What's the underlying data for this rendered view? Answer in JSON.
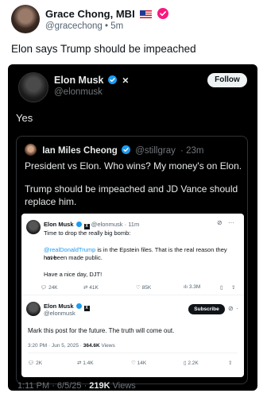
{
  "post": {
    "author_name": "Grace Chong, MBI",
    "author_handle": "@gracechong",
    "dot": "•",
    "age": "5m",
    "text": "Elon says Trump should be impeached"
  },
  "embed": {
    "author_name": "Elon Musk",
    "author_handle": "@elonmusk",
    "follow_label": "Follow",
    "text": "Yes",
    "meta_time": "1:11 PM · 6/5/25 · ",
    "meta_views": "219K",
    "meta_views_label": " Views",
    "quote": {
      "author_name": "Ian Miles Cheong",
      "author_handle": "@stillgray",
      "age": "· 23m",
      "text1": "President vs Elon. Who wins? My money's on Elon.",
      "text2": "Trump should be impeached and JD Vance should replace him."
    }
  },
  "screenshot": {
    "tweet1": {
      "author_name": "Elon Musk",
      "author_handle": "@elonmusk",
      "age": "· 11m",
      "line1": "Time to drop the really big bomb:",
      "mention": "@realDonaldTrump",
      "line2_rest": " is in the Epstein files. That is the real reason they have",
      "line3": "not been made public.",
      "line4": "Have a nice day, DJT!",
      "replies": "24K",
      "reposts": "41K",
      "likes": "85K",
      "views": "3.3M"
    },
    "tweet2": {
      "author_name": "Elon Musk",
      "author_handle": "@elonmusk",
      "subscribe_label": "Subscribe",
      "text": "Mark this post for the future. The truth will come out.",
      "meta_time": "3:20 PM · Jun 5, 2025 · ",
      "meta_views": "364.6K",
      "meta_views_label": " Views",
      "replies": "2K",
      "reposts": "1.4K",
      "likes": "14K",
      "bookmarks": "2.2K"
    }
  },
  "colors": {
    "brand_blue": "#1d9bf0",
    "badge_pink": "#f91880",
    "card_bg": "#000000"
  },
  "icons": [
    "verified-badge-icon",
    "x-logo-icon",
    "reply-icon",
    "repost-icon",
    "like-icon",
    "views-icon",
    "bookmark-icon",
    "share-icon",
    "more-icon",
    "grok-icon",
    "flag-icon"
  ]
}
